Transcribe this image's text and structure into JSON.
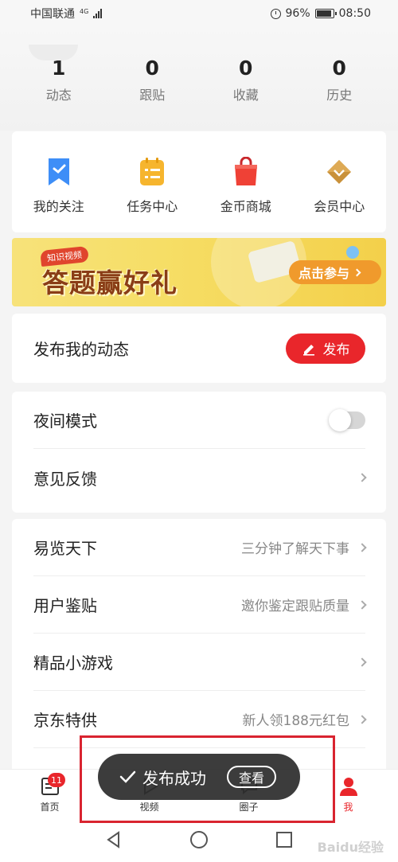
{
  "status_bar": {
    "carrier": "中国联通",
    "network": "4G",
    "battery_pct": "96%",
    "time": "08:50"
  },
  "stats": [
    {
      "value": "1",
      "label": "动态"
    },
    {
      "value": "0",
      "label": "跟贴"
    },
    {
      "value": "0",
      "label": "收藏"
    },
    {
      "value": "0",
      "label": "历史"
    }
  ],
  "features": [
    {
      "label": "我的关注",
      "icon": "bookmark-icon",
      "color": "#3e8ef7"
    },
    {
      "label": "任务中心",
      "icon": "task-list-icon",
      "color": "#f6b52e"
    },
    {
      "label": "金币商城",
      "icon": "shopping-bag-icon",
      "color": "#ef4136"
    },
    {
      "label": "会员中心",
      "icon": "diamond-icon",
      "color": "#c9913a"
    }
  ],
  "banner": {
    "tag": "知识视频",
    "title": "答题赢好礼",
    "cta": "点击参与"
  },
  "publish": {
    "title": "发布我的动态",
    "button": "发布"
  },
  "settings": [
    {
      "label": "夜间模式",
      "type": "toggle",
      "enabled": false
    },
    {
      "label": "意见反馈",
      "type": "link"
    }
  ],
  "links": [
    {
      "label": "易览天下",
      "sub": "三分钟了解天下事"
    },
    {
      "label": "用户鉴贴",
      "sub": "邀你鉴定跟贴质量"
    },
    {
      "label": "精品小游戏",
      "sub": ""
    },
    {
      "label": "京东特供",
      "sub": "新人领188元红包"
    },
    {
      "label": "",
      "sub": ""
    }
  ],
  "tabs": [
    {
      "label": "首页",
      "badge": "11",
      "active": false
    },
    {
      "label": "视频",
      "active": false
    },
    {
      "label": "圈子",
      "active": false
    },
    {
      "label": "我",
      "active": true
    }
  ],
  "toast": {
    "message": "发布成功",
    "action": "查看"
  },
  "watermark": "Baidu经验",
  "colors": {
    "accent": "#e9262b",
    "toast_bg": "#2d2d2d",
    "highlight": "#d92430"
  }
}
